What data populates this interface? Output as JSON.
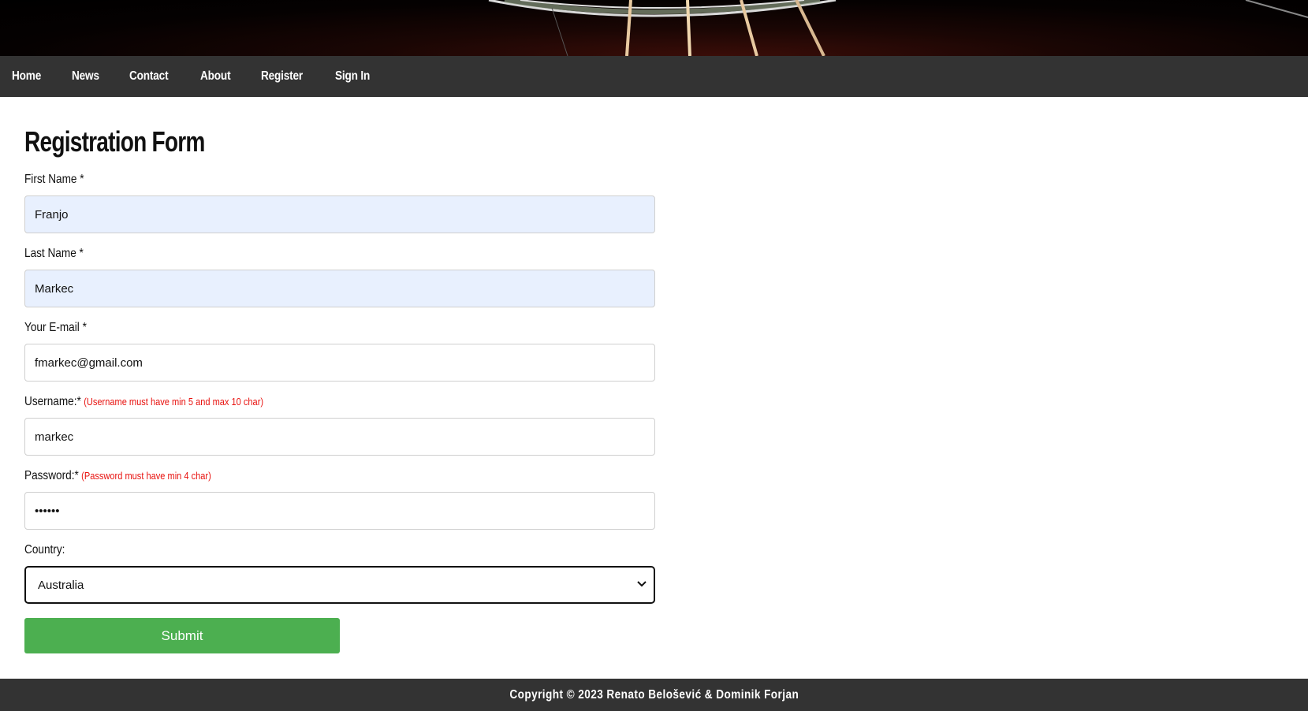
{
  "nav": {
    "items": [
      {
        "label": "Home"
      },
      {
        "label": "News"
      },
      {
        "label": "Contact"
      },
      {
        "label": "About"
      },
      {
        "label": "Register"
      },
      {
        "label": "Sign In"
      }
    ]
  },
  "form": {
    "title": "Registration Form",
    "first_name": {
      "label": "First Name *",
      "value": "Franjo"
    },
    "last_name": {
      "label": "Last Name *",
      "value": "Markec"
    },
    "email": {
      "label": "Your E-mail *",
      "value": "fmarkec@gmail.com"
    },
    "username": {
      "label": "Username:*",
      "hint": "(Username must have min 5 and max 10 char)",
      "value": "markec"
    },
    "password": {
      "label": "Password:*",
      "hint": "(Password must have min 4 char)",
      "value": "••••••"
    },
    "country": {
      "label": "Country:",
      "selected": "Australia"
    },
    "submit_label": "Submit"
  },
  "footer": {
    "copyright": "Copyright © 2023 Renato Belošević & Dominik Forjan"
  },
  "colors": {
    "nav_bg": "#333333",
    "submit_bg": "#4caf50",
    "hint": "#e8120f",
    "autofill_bg": "#e8f0fe"
  },
  "icons": {
    "select_arrow": "chevron-down-icon",
    "banner": "guitar-strings-image"
  }
}
